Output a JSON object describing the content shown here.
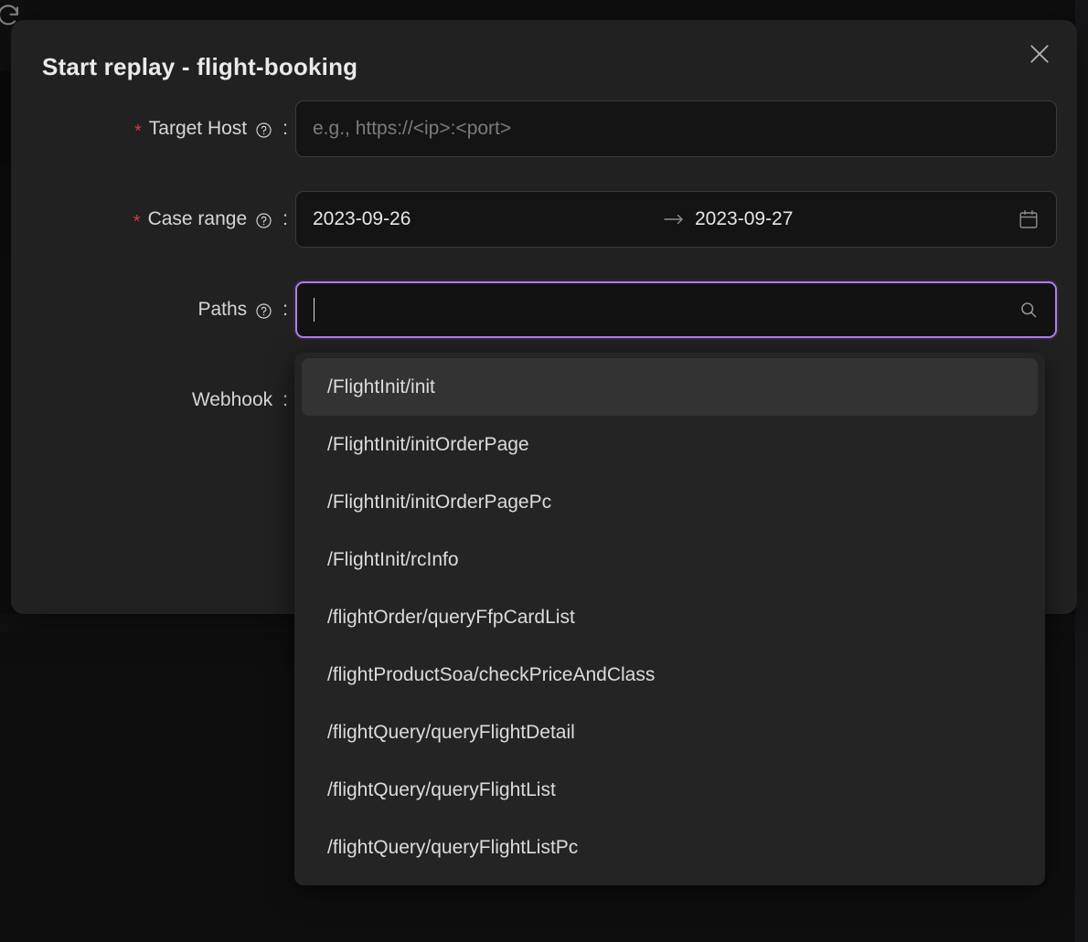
{
  "background": {
    "refresh_icon": "refresh-icon"
  },
  "modal": {
    "title": "Start replay - flight-booking",
    "close_icon": "close-icon",
    "fields": {
      "target_host": {
        "label": "Target Host",
        "required_marker": "*",
        "help_icon": "question-circle-icon",
        "colon": ":",
        "value": "",
        "placeholder": "e.g., https://<ip>:<port>"
      },
      "case_range": {
        "label": "Case range",
        "required_marker": "*",
        "help_icon": "question-circle-icon",
        "colon": ":",
        "start_date": "2023-09-26",
        "separator_icon": "arrow-right-icon",
        "end_date": "2023-09-27",
        "calendar_icon": "calendar-icon"
      },
      "paths": {
        "label": "Paths",
        "help_icon": "question-circle-icon",
        "colon": ":",
        "value": "",
        "placeholder": "",
        "search_icon": "search-icon",
        "focused": true
      },
      "webhook": {
        "label": "Webhook",
        "colon": ":",
        "value": ""
      }
    }
  },
  "paths_dropdown": {
    "options": [
      "/FlightInit/init",
      "/FlightInit/initOrderPage",
      "/FlightInit/initOrderPagePc",
      "/FlightInit/rcInfo",
      "/flightOrder/queryFfpCardList",
      "/flightProductSoa/checkPriceAndClass",
      "/flightQuery/queryFlightDetail",
      "/flightQuery/queryFlightList",
      "/flightQuery/queryFlightListPc"
    ],
    "active_index": 0
  },
  "colors": {
    "modal_bg": "#212121",
    "page_bg": "#0d0d0d",
    "input_bg": "#141414",
    "focus_border": "#b07ee8",
    "required_red": "#d9363e",
    "dropdown_bg": "#242424",
    "option_active_bg": "#333333",
    "text_primary": "#e6e6e6",
    "text_placeholder": "#7b7b7b"
  }
}
